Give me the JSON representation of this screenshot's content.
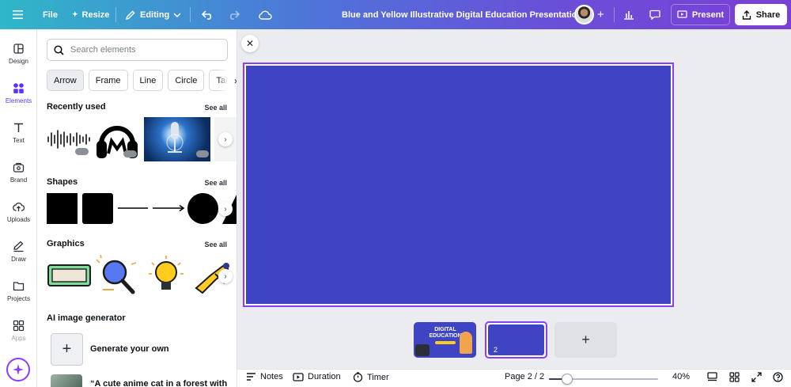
{
  "topbar": {
    "menu_icon": "hamburger-icon",
    "file": "File",
    "resize": "Resize",
    "editing": "Editing",
    "title": "Blue and Yellow Illustrative Digital Education Presentation",
    "present": "Present",
    "share": "Share"
  },
  "rail": {
    "items": [
      {
        "label": "Design",
        "icon": "design-icon"
      },
      {
        "label": "Elements",
        "icon": "elements-icon"
      },
      {
        "label": "Text",
        "icon": "text-icon"
      },
      {
        "label": "Brand",
        "icon": "brand-icon"
      },
      {
        "label": "Uploads",
        "icon": "uploads-icon"
      },
      {
        "label": "Draw",
        "icon": "draw-icon"
      },
      {
        "label": "Projects",
        "icon": "projects-icon"
      },
      {
        "label": "Apps",
        "icon": "apps-icon"
      }
    ]
  },
  "panel": {
    "search_placeholder": "Search elements",
    "chips": [
      "Arrow",
      "Frame",
      "Line",
      "Circle",
      "Table"
    ],
    "recent": {
      "title": "Recently used",
      "see_all": "See all"
    },
    "shapes": {
      "title": "Shapes",
      "see_all": "See all"
    },
    "graphics": {
      "title": "Graphics",
      "see_all": "See all"
    },
    "ai": {
      "title": "AI image generator",
      "generate": "Generate your own",
      "prompt_example": "“A cute anime cat in a forest with"
    }
  },
  "canvas": {
    "page_color": "#3f44c4"
  },
  "thumbnails": {
    "page1": {
      "line1": "DIGITAL",
      "line2": "EDUCATION"
    },
    "page2_number": "2"
  },
  "bottombar": {
    "notes": "Notes",
    "duration": "Duration",
    "timer": "Timer",
    "page_indicator": "Page 2 / 2",
    "zoom": "40%",
    "zoom_fraction": 0.17
  },
  "colors": {
    "accent": "#8b3dff",
    "page_blue": "#3f44c4"
  }
}
